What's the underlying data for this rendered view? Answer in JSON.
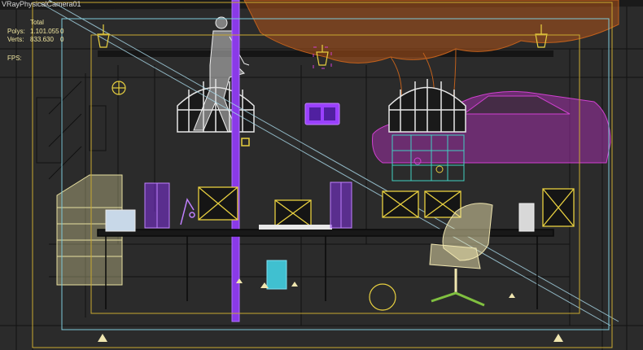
{
  "viewport": {
    "camera_name": "VRayPhysicalCamera01"
  },
  "statistics": {
    "header": "Total",
    "polys_label": "Polys:",
    "polys_value": "1.101.055",
    "polys_selected": "0",
    "verts_label": "Verts:",
    "verts_value": "833.630",
    "verts_selected": "0",
    "fps_label": "FPS:"
  },
  "colors": {
    "background": "#2b2b2b",
    "safe_frame_outer": "#7ec8d8",
    "safe_frame_inner": "#c8a830",
    "wireframe_white": "#e8e8e8",
    "wireframe_purple": "#9a40ff",
    "wireframe_magenta": "#d040d0",
    "wireframe_orange": "#c0601c",
    "wireframe_yellow": "#e8d040",
    "wireframe_cream": "#f0e6b0",
    "wireframe_cyan": "#40d0c0",
    "wireframe_green": "#80c040",
    "stats_text": "#f0e6a0"
  }
}
